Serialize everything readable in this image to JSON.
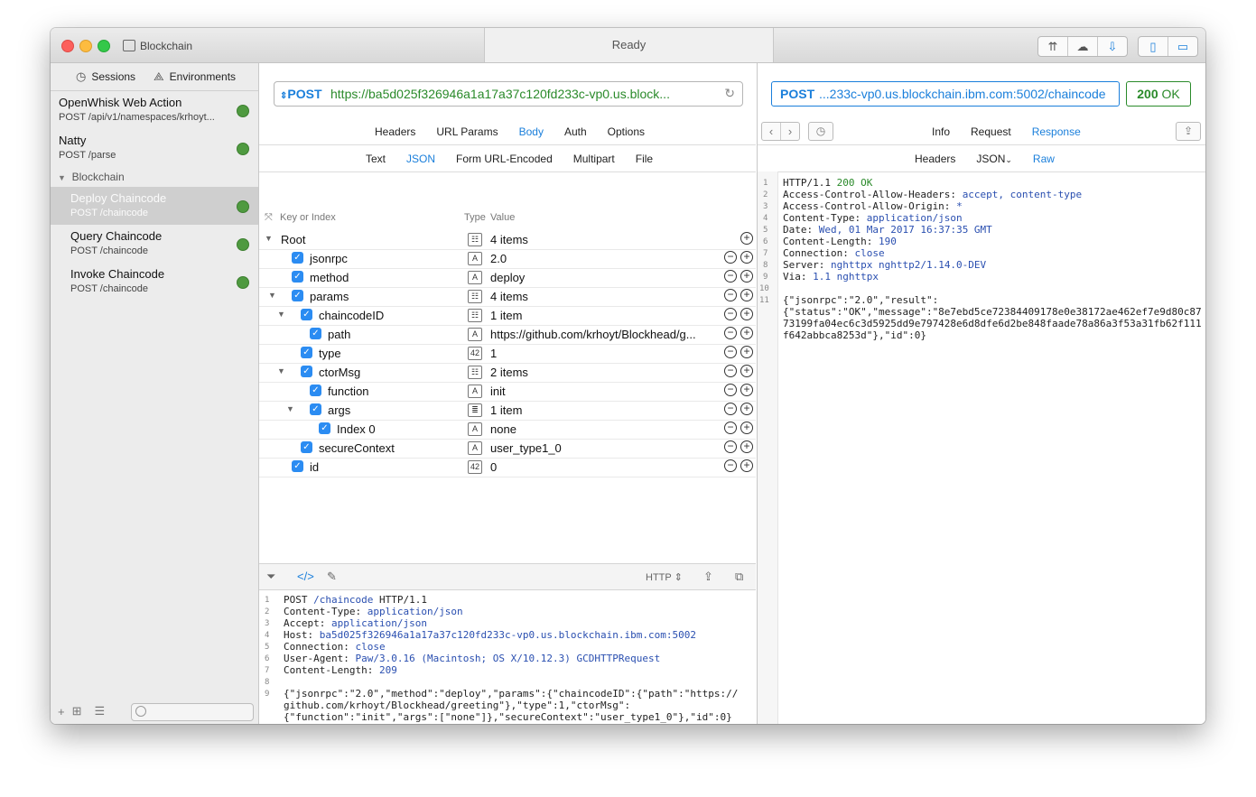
{
  "window": {
    "document_title": "Blockchain",
    "status": "Ready"
  },
  "sidebar": {
    "tabs": {
      "sessions": "Sessions",
      "environments": "Environments"
    },
    "items": [
      {
        "title": "OpenWhisk Web Action",
        "subtitle": "POST /api/v1/namespaces/krhoyt..."
      },
      {
        "title": "Natty",
        "subtitle": "POST /parse"
      }
    ],
    "group": "Blockchain",
    "group_items": [
      {
        "title": "Deploy Chaincode",
        "subtitle": "POST /chaincode",
        "selected": true
      },
      {
        "title": "Query Chaincode",
        "subtitle": "POST /chaincode"
      },
      {
        "title": "Invoke Chaincode",
        "subtitle": "POST /chaincode"
      }
    ],
    "status_color": "#4f9a40"
  },
  "request": {
    "method": "POST",
    "url": "https://ba5d025f326946a1a17a37c120fd233c-vp0.us.block...",
    "tabs": [
      "Headers",
      "URL Params",
      "Body",
      "Auth",
      "Options"
    ],
    "active_tab": "Body",
    "body_tabs": [
      "Text",
      "JSON",
      "Form URL-Encoded",
      "Multipart",
      "File"
    ],
    "active_body_tab": "JSON",
    "tree_header": {
      "key": "Key or Index",
      "type": "Type",
      "value": "Value"
    },
    "tree": [
      {
        "key": "Root",
        "type": "obj",
        "value": "4 items"
      },
      {
        "key": "jsonrpc",
        "type": "A",
        "value": "2.0"
      },
      {
        "key": "method",
        "type": "A",
        "value": "deploy"
      },
      {
        "key": "params",
        "type": "obj",
        "value": "4 items"
      },
      {
        "key": "chaincodeID",
        "type": "obj",
        "value": "1 item"
      },
      {
        "key": "path",
        "type": "A",
        "value": "https://github.com/krhoyt/Blockhead/g..."
      },
      {
        "key": "type",
        "type": "42",
        "value": "1"
      },
      {
        "key": "ctorMsg",
        "type": "obj",
        "value": "2 items"
      },
      {
        "key": "function",
        "type": "A",
        "value": "init"
      },
      {
        "key": "args",
        "type": "arr",
        "value": "1 item"
      },
      {
        "key": "Index 0",
        "type": "A",
        "value": "none"
      },
      {
        "key": "secureContext",
        "type": "A",
        "value": "user_type1_0"
      },
      {
        "key": "id",
        "type": "42",
        "value": "0"
      }
    ],
    "raw_format": "HTTP",
    "raw_lines": [
      {
        "n": "1",
        "a": "POST ",
        "b": "/chaincode",
        "c": " HTTP/1.1"
      },
      {
        "n": "2",
        "a": "Content-Type: ",
        "b": "application/json",
        "c": ""
      },
      {
        "n": "3",
        "a": "Accept: ",
        "b": "application/json",
        "c": ""
      },
      {
        "n": "4",
        "a": "Host: ",
        "b": "ba5d025f326946a1a17a37c120fd233c-vp0.us.blockchain.ibm.com:5002",
        "c": ""
      },
      {
        "n": "5",
        "a": "Connection: ",
        "b": "close",
        "c": ""
      },
      {
        "n": "6",
        "a": "User-Agent: ",
        "b": "Paw/3.0.16 (Macintosh; OS X/10.12.3) GCDHTTPRequest",
        "c": ""
      },
      {
        "n": "7",
        "a": "Content-Length: ",
        "b": "209",
        "c": ""
      },
      {
        "n": "8",
        "a": "",
        "b": "",
        "c": ""
      },
      {
        "n": "9",
        "a": "{\"jsonrpc\":\"2.0\",\"method\":\"deploy\",\"params\":{\"chaincodeID\":{\"path\":\"https://",
        "b": "",
        "c": ""
      },
      {
        "n": "",
        "a": "github.com/krhoyt/Blockhead/greeting\"},\"type\":1,\"ctorMsg\":",
        "b": "",
        "c": ""
      },
      {
        "n": "",
        "a": "{\"function\":\"init\",\"args\":[\"none\"]},\"secureContext\":\"user_type1_0\"},\"id\":0}",
        "b": "",
        "c": ""
      }
    ]
  },
  "response": {
    "method": "POST",
    "url": "...233c-vp0.us.blockchain.ibm.com:5002/chaincode",
    "status_code": "200",
    "status_text": "OK",
    "tabs": [
      "Info",
      "Request",
      "Response"
    ],
    "active_tab": "Response",
    "sub_tabs": [
      "Headers",
      "JSON",
      "Raw"
    ],
    "active_sub_tab": "Raw",
    "lines": [
      {
        "n": "1",
        "a": "HTTP/1.1 ",
        "b": "200 OK",
        "c": "",
        "g": true
      },
      {
        "n": "2",
        "a": "Access-Control-Allow-Headers: ",
        "b": "accept, content-type",
        "c": ""
      },
      {
        "n": "3",
        "a": "Access-Control-Allow-Origin: ",
        "b": "*",
        "c": ""
      },
      {
        "n": "4",
        "a": "Content-Type: ",
        "b": "application/json",
        "c": ""
      },
      {
        "n": "5",
        "a": "Date: ",
        "b": "Wed, 01 Mar 2017 16:37:35 GMT",
        "c": ""
      },
      {
        "n": "6",
        "a": "Content-Length: ",
        "b": "190",
        "c": ""
      },
      {
        "n": "7",
        "a": "Connection: ",
        "b": "close",
        "c": ""
      },
      {
        "n": "8",
        "a": "Server: ",
        "b": "nghttpx nghttp2/1.14.0-DEV",
        "c": ""
      },
      {
        "n": "9",
        "a": "Via: ",
        "b": "1.1 nghttpx",
        "c": ""
      },
      {
        "n": "10",
        "a": "",
        "b": "",
        "c": ""
      },
      {
        "n": "11",
        "a": "{\"jsonrpc\":\"2.0\",\"result\":",
        "b": "",
        "c": ""
      },
      {
        "n": "",
        "a": "{\"status\":\"OK\",\"message\":\"8e7ebd5ce72384409178e0e38172ae462ef7e9d80c87",
        "b": "",
        "c": ""
      },
      {
        "n": "",
        "a": "73199fa04ec6c3d5925dd9e797428e6d8dfe6d2be848faade78a86a3f53a31fb62f111",
        "b": "",
        "c": ""
      },
      {
        "n": "",
        "a": "f642abbca8253d\"},\"id\":0}",
        "b": "",
        "c": ""
      }
    ]
  },
  "colors": {
    "accent": "#1a7fdb",
    "ok": "#2a8a2a",
    "checkbox": "#2b8cf2"
  }
}
